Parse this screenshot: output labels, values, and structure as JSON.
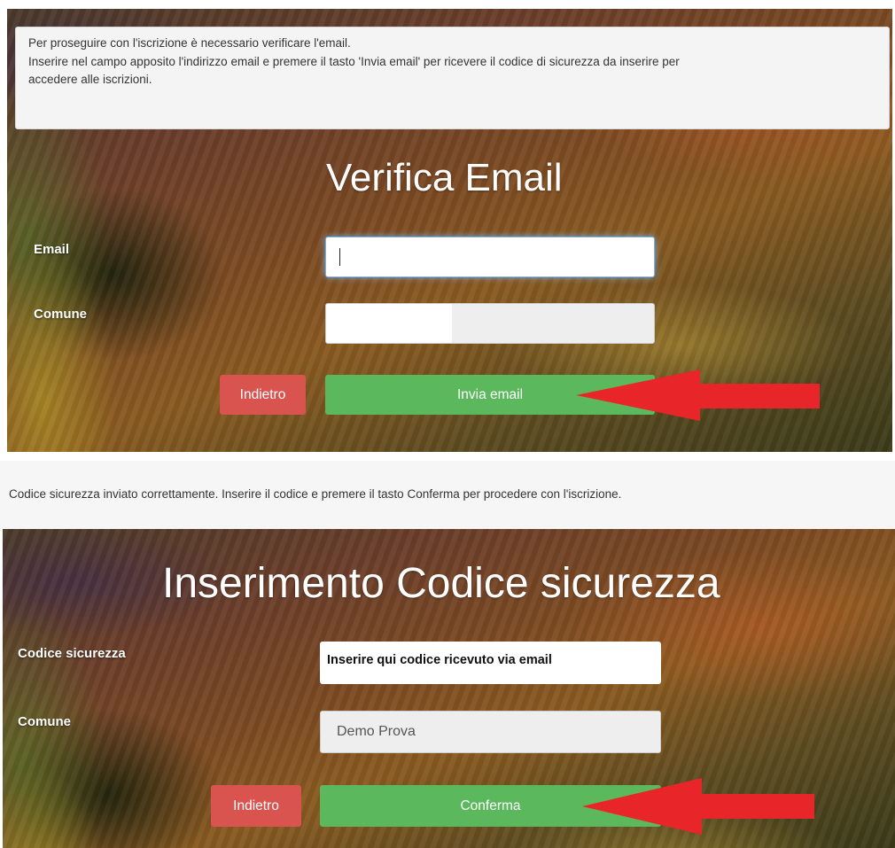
{
  "step1": {
    "info_lines": [
      "Per proseguire con l'iscrizione è necessario verificare l'email.",
      "Inserire nel campo apposito l'indirizzo email e premere il tasto 'Invia email' per ricevere il codice di sicurezza da inserire per",
      "accedere alle iscrizioni."
    ],
    "title": "Verifica Email",
    "email_label": "Email",
    "email_value": "",
    "comune_label": "Comune",
    "back_label": "Indietro",
    "send_label": "Invia email"
  },
  "step2": {
    "info_text": "Codice sicurezza inviato correttamente. Inserire il codice e premere il tasto Conferma per procedere con l'iscrizione.",
    "title": "Inserimento Codice sicurezza",
    "codice_label": "Codice sicurezza",
    "codice_annotation": "Inserire qui codice ricevuto via email",
    "comune_label": "Comune",
    "comune_value": "Demo Prova",
    "back_label": "Indietro",
    "confirm_label": "Conferma"
  },
  "colors": {
    "success": "#5cb85c",
    "danger": "#d9534f",
    "annotation_arrow": "#e8262a",
    "focus_glow": "#7fb3e6"
  },
  "icons": [
    "red-arrow-annotation",
    "text-caret"
  ]
}
